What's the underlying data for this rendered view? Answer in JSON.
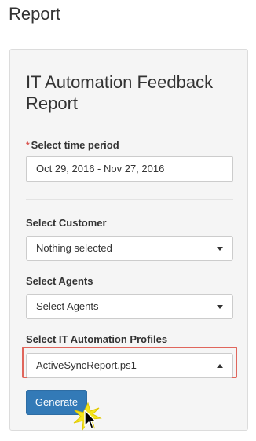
{
  "page": {
    "title": "Report"
  },
  "report": {
    "title": "IT Automation Feedback Report",
    "time_period": {
      "required_mark": "*",
      "label": "Select time period",
      "value": "Oct 29, 2016 - Nov 27, 2016"
    },
    "customer": {
      "label": "Select Customer",
      "value": "Nothing selected"
    },
    "agents": {
      "label": "Select Agents",
      "value": "Select Agents"
    },
    "profiles": {
      "label": "Select IT Automation Profiles",
      "value": "ActiveSyncReport.ps1",
      "expanded": true
    },
    "generate_label": "Generate"
  },
  "colors": {
    "primary_button": "#337ab7",
    "highlight_border": "#e0665c",
    "required": "#d9534f",
    "cursor_burst": "#f5e61c"
  },
  "icons": {
    "dropdown": "caret-down-icon",
    "dropdown_open": "caret-up-icon",
    "cursor": "mouse-pointer-icon"
  }
}
